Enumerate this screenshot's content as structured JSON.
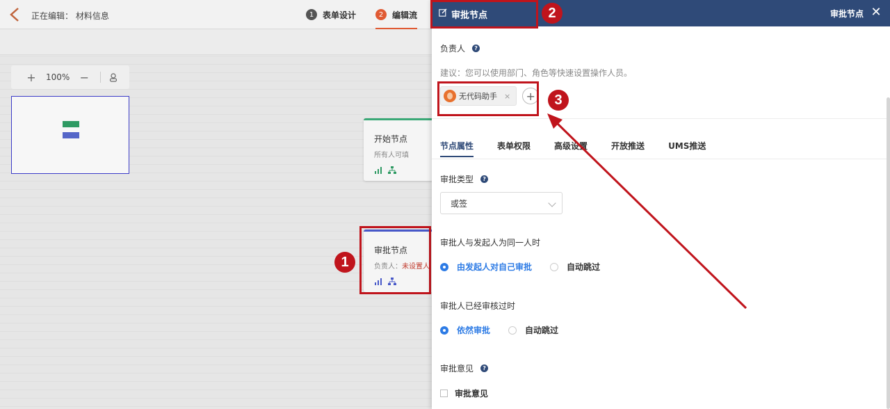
{
  "topbar": {
    "editing_label": "正在编辑：  材料信息",
    "steps": [
      {
        "num": "1",
        "label": "表单设计"
      },
      {
        "num": "2",
        "label": "编辑流"
      }
    ]
  },
  "zoom": {
    "plus": "+",
    "value": "100%",
    "minus": "−"
  },
  "flow": {
    "start_node": {
      "title": "开始节点",
      "sub": "所有人可填"
    },
    "approve_node": {
      "title": "审批节点",
      "sub_label": "负责人：",
      "sub_warn": "未设置人"
    }
  },
  "drawer": {
    "title": "审批节点",
    "right_title": "审批节点",
    "close": "✕",
    "owner_label": "负责人",
    "help": "?",
    "hint": "建议：您可以使用部门、角色等快速设置操作人员。",
    "chip_name": "无代码助手",
    "chip_remove": "×",
    "add": "+",
    "tabs": [
      "节点属性",
      "表单权限",
      "高级设置",
      "开放推送",
      "UMS推送"
    ],
    "approve_type_label": "审批类型",
    "approve_type_value": "或签",
    "same_person_label": "审批人与发起人为同一人时",
    "same_person_options": [
      "由发起人对自己审批",
      "自动跳过"
    ],
    "reviewed_label": "审批人已经审核过时",
    "reviewed_options": [
      "依然审批",
      "自动跳过"
    ],
    "opinion_label": "审批意见",
    "opinion_checkbox": "审批意见"
  },
  "annotations": {
    "b1": "1",
    "b2": "2",
    "b3": "3"
  },
  "colors": {
    "accent": "#2f4a78",
    "marker": "#c0141c",
    "link": "#2d7be5"
  }
}
